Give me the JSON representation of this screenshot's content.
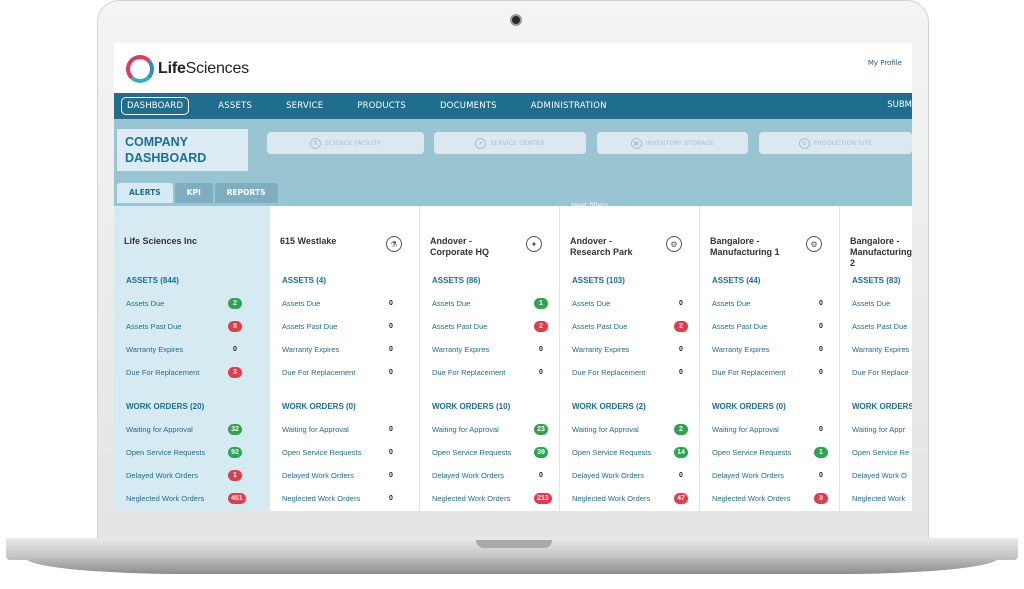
{
  "app": {
    "logo_bold": "Life",
    "logo_rest": "Sciences",
    "my_profile": "My Profile"
  },
  "nav": {
    "items": [
      "DASHBOARD",
      "ASSETS",
      "SERVICE",
      "PRODUCTS",
      "DOCUMENTS",
      "ADMINISTRATION"
    ],
    "right": "SUBM"
  },
  "company": {
    "title_line1": "COMPANY",
    "title_line2": "DASHBOARD"
  },
  "sites": [
    "SCIENCE FACILITY",
    "SERVICE CENTER",
    "INVENTORY STORAGE",
    "PRODUCTION SITE"
  ],
  "reset_filters": "reset filters",
  "tabs": [
    "ALERTS",
    "KPI",
    "REPORTS"
  ],
  "columns": [
    {
      "name": "Life Sciences Inc",
      "assets_title": "ASSETS (844)",
      "assets": [
        {
          "label": "Assets Due",
          "value": "2",
          "style": "green"
        },
        {
          "label": "Assets Past Due",
          "value": "8",
          "style": "red"
        },
        {
          "label": "Warranty Expires",
          "value": "0",
          "style": "plain"
        },
        {
          "label": "Due For Replacement",
          "value": "3",
          "style": "red"
        }
      ],
      "wo_title": "WORK ORDERS (20)",
      "work_orders": [
        {
          "label": "Waiting for Approval",
          "value": "32",
          "style": "green"
        },
        {
          "label": "Open Service Requests",
          "value": "92",
          "style": "green"
        },
        {
          "label": "Delayed Work Orders",
          "value": "1",
          "style": "red"
        },
        {
          "label": "Neglected Work Orders",
          "value": "451",
          "style": "red"
        }
      ]
    },
    {
      "name": "615 Westlake",
      "assets_title": "ASSETS (4)",
      "assets": [
        {
          "label": "Assets Due",
          "value": "0",
          "style": "plain"
        },
        {
          "label": "Assets Past Due",
          "value": "0",
          "style": "plain"
        },
        {
          "label": "Warranty Expires",
          "value": "0",
          "style": "plain"
        },
        {
          "label": "Due For Replacement",
          "value": "0",
          "style": "plain"
        }
      ],
      "wo_title": "WORK ORDERS (0)",
      "work_orders": [
        {
          "label": "Waiting for Approval",
          "value": "0",
          "style": "plain"
        },
        {
          "label": "Open Service Requests",
          "value": "0",
          "style": "plain"
        },
        {
          "label": "Delayed Work Orders",
          "value": "0",
          "style": "plain"
        },
        {
          "label": "Neglected Work Orders",
          "value": "0",
          "style": "plain"
        }
      ]
    },
    {
      "name": "Andover -\nCorporate HQ",
      "assets_title": "ASSETS (86)",
      "assets": [
        {
          "label": "Assets Due",
          "value": "1",
          "style": "green"
        },
        {
          "label": "Assets Past Due",
          "value": "2",
          "style": "red"
        },
        {
          "label": "Warranty Expires",
          "value": "0",
          "style": "plain"
        },
        {
          "label": "Due For Replacement",
          "value": "0",
          "style": "plain"
        }
      ],
      "wo_title": "WORK ORDERS (10)",
      "work_orders": [
        {
          "label": "Waiting for Approval",
          "value": "23",
          "style": "green"
        },
        {
          "label": "Open Service Requests",
          "value": "39",
          "style": "green"
        },
        {
          "label": "Delayed Work Orders",
          "value": "0",
          "style": "plain"
        },
        {
          "label": "Neglected Work Orders",
          "value": "213",
          "style": "red"
        }
      ]
    },
    {
      "name": "Andover -\nResearch Park",
      "assets_title": "ASSETS (103)",
      "assets": [
        {
          "label": "Assets Due",
          "value": "0",
          "style": "plain"
        },
        {
          "label": "Assets Past Due",
          "value": "2",
          "style": "red"
        },
        {
          "label": "Warranty Expires",
          "value": "0",
          "style": "plain"
        },
        {
          "label": "Due For Replacement",
          "value": "0",
          "style": "plain"
        }
      ],
      "wo_title": "WORK ORDERS (2)",
      "work_orders": [
        {
          "label": "Waiting for Approval",
          "value": "2",
          "style": "green"
        },
        {
          "label": "Open Service Requests",
          "value": "14",
          "style": "green"
        },
        {
          "label": "Delayed Work Orders",
          "value": "0",
          "style": "plain"
        },
        {
          "label": "Neglected Work Orders",
          "value": "47",
          "style": "red"
        }
      ]
    },
    {
      "name": "Bangalore -\nManufacturing 1",
      "assets_title": "ASSETS (44)",
      "assets": [
        {
          "label": "Assets Due",
          "value": "0",
          "style": "plain"
        },
        {
          "label": "Assets Past Due",
          "value": "0",
          "style": "plain"
        },
        {
          "label": "Warranty Expires",
          "value": "0",
          "style": "plain"
        },
        {
          "label": "Due For Replacement",
          "value": "0",
          "style": "plain"
        }
      ],
      "wo_title": "WORK ORDERS (0)",
      "work_orders": [
        {
          "label": "Waiting for Approval",
          "value": "0",
          "style": "plain"
        },
        {
          "label": "Open Service Requests",
          "value": "1",
          "style": "green"
        },
        {
          "label": "Delayed Work Orders",
          "value": "0",
          "style": "plain"
        },
        {
          "label": "Neglected Work Orders",
          "value": "9",
          "style": "red"
        }
      ]
    },
    {
      "name": "Bangalore -\nManufacturing\n2",
      "assets_title": "ASSETS (83)",
      "assets": [
        {
          "label": "Assets Due",
          "value": "",
          "style": "plain"
        },
        {
          "label": "Assets Past Due",
          "value": "",
          "style": "plain"
        },
        {
          "label": "Warranty Expires",
          "value": "",
          "style": "plain"
        },
        {
          "label": "Due For Replace",
          "value": "",
          "style": "plain"
        }
      ],
      "wo_title": "WORK ORDERS (",
      "work_orders": [
        {
          "label": "Waiting for Appr",
          "value": "",
          "style": "plain"
        },
        {
          "label": "Open Service Re",
          "value": "",
          "style": "plain"
        },
        {
          "label": "Delayed Work O",
          "value": "",
          "style": "plain"
        },
        {
          "label": "Neglected Work",
          "value": "",
          "style": "plain"
        }
      ]
    }
  ]
}
